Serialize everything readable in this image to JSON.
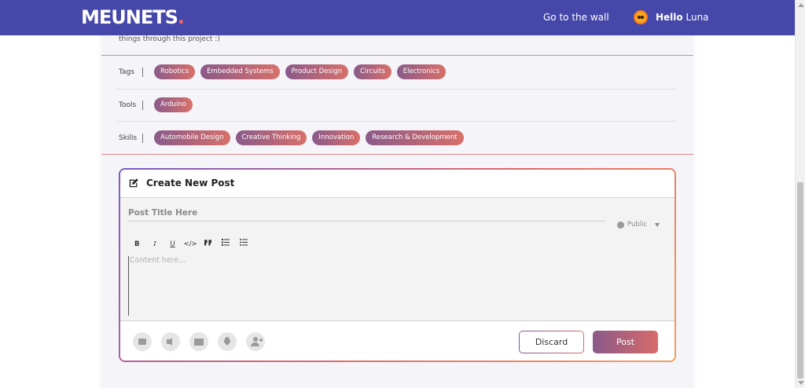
{
  "navbar": {
    "logo_text": "MEUNETS",
    "logo_dot": ".",
    "wall_link": "Go to the wall",
    "greeting_prefix": "Hello",
    "user_name": "Luna"
  },
  "project": {
    "truncated_text": "things through this project :)",
    "tags_label": "Tags",
    "tags": [
      "Robotics",
      "Embedded Systems",
      "Product Design",
      "Circuits",
      "Electronics"
    ],
    "tools_label": "Tools",
    "tools": [
      "Arduino"
    ],
    "skills_label": "Skills",
    "skills": [
      "Automobile Design",
      "Creative Thinking",
      "Innovation",
      "Research & Development"
    ]
  },
  "create_post": {
    "header_title": "Create New Post",
    "title_placeholder": "Post Title Here",
    "visibility": "Public",
    "toolbar": [
      "B",
      "I",
      "U",
      "</>",
      "99",
      "ol",
      "ul"
    ],
    "content_placeholder": "Content here...",
    "discard_label": "Discard",
    "post_label": "Post",
    "actions": [
      "image-icon",
      "audio-icon",
      "folder-icon",
      "location-icon",
      "add-person-icon"
    ]
  },
  "colors": {
    "nav_bg": "#4547a9",
    "chip_gradient_start": "#8a5a8a",
    "chip_gradient_end": "#d8706a",
    "logo_dot": "#ef6b6b"
  }
}
